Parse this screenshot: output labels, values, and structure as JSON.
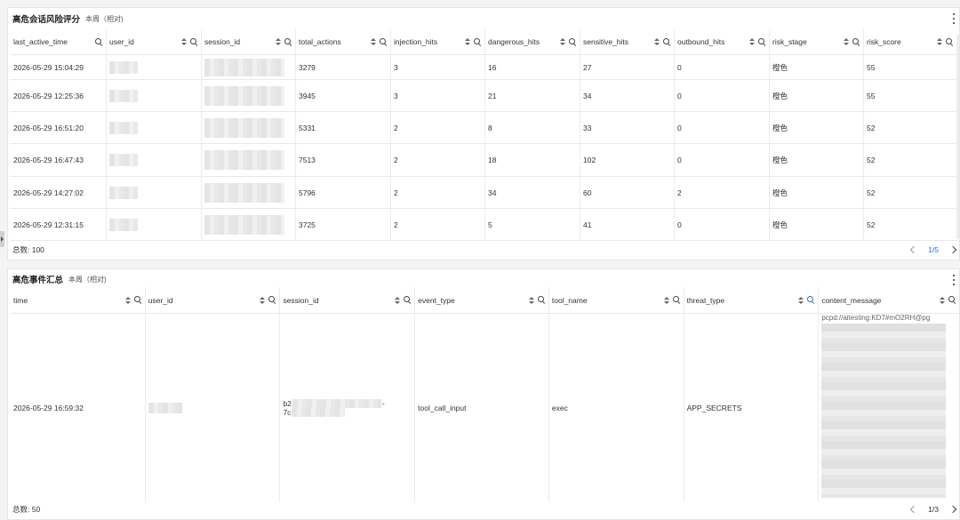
{
  "panel1": {
    "title": "高危会话风险评分",
    "subtitle": "本周（相对)",
    "columns": [
      "last_active_time",
      "user_id",
      "session_id",
      "total_actions",
      "injection_hits",
      "dangerous_hits",
      "sensitive_hits",
      "outbound_hits",
      "risk_stage",
      "risk_score"
    ],
    "rows": [
      [
        "2026-05-29 15:04:29",
        "",
        "",
        "3279",
        "3",
        "16",
        "27",
        "0",
        "橙色",
        "55"
      ],
      [
        "2026-05-29 12:25:36",
        "",
        "",
        "3945",
        "3",
        "21",
        "34",
        "0",
        "橙色",
        "55"
      ],
      [
        "2026-05-29 16:51:20",
        "",
        "",
        "5331",
        "2",
        "8",
        "33",
        "0",
        "橙色",
        "52"
      ],
      [
        "2026-05-29 16:47:43",
        "",
        "",
        "7513",
        "2",
        "18",
        "102",
        "0",
        "橙色",
        "52"
      ],
      [
        "2026-05-29 14:27:02",
        "",
        "",
        "5796",
        "2",
        "34",
        "60",
        "2",
        "橙色",
        "52"
      ],
      [
        "2026-05-29 12:31:15",
        "",
        "",
        "3725",
        "2",
        "5",
        "41",
        "0",
        "橙色",
        "52"
      ]
    ],
    "total": "总数: 100",
    "page": "1/5"
  },
  "panel2": {
    "title": "高危事件汇总",
    "subtitle": "本周（相对)",
    "columns": [
      "time",
      "user_id",
      "session_id",
      "event_type",
      "tool_name",
      "threat_type",
      "content_message"
    ],
    "row": {
      "time": "2026-05-29 16:59:32",
      "session_prefix_1": "b2",
      "session_prefix_2": "7c",
      "event_type": "tool_call_input",
      "tool_name": "exec",
      "threat_type": "APP_SECRETS",
      "content_top": "pcpd://aitesting:KD7#mO2RH@pg"
    },
    "total": "总数: 50",
    "page": "1/3"
  },
  "colors": {
    "accent": "#2f6fd6",
    "border": "#e6e6e6",
    "background": "#f3f4f6"
  },
  "icons": [
    "sort-icon",
    "search-icon",
    "kebab-menu-icon",
    "chevron-left-icon",
    "chevron-right-icon",
    "sidebar-toggle-icon"
  ]
}
